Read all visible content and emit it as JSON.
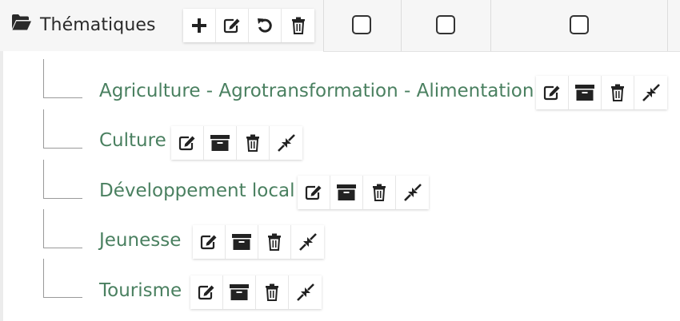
{
  "header": {
    "title": "Thématiques",
    "icons": [
      "folder-open-icon",
      "plus-icon",
      "edit-icon",
      "undo-icon",
      "trash-icon"
    ],
    "checkbox_count": 3
  },
  "tree": {
    "items": [
      {
        "label": "Agriculture - Agrotransformation - Alimentation"
      },
      {
        "label": "Culture"
      },
      {
        "label": "Développement local"
      },
      {
        "label": "Jeunesse"
      },
      {
        "label": "Tourisme"
      }
    ],
    "item_actions": [
      "edit-icon",
      "archive-icon",
      "trash-icon",
      "compress-icon"
    ]
  },
  "colors": {
    "link_green": "#4a8060",
    "header_bg": "#f6f6f6",
    "icon_dark": "#222222"
  }
}
